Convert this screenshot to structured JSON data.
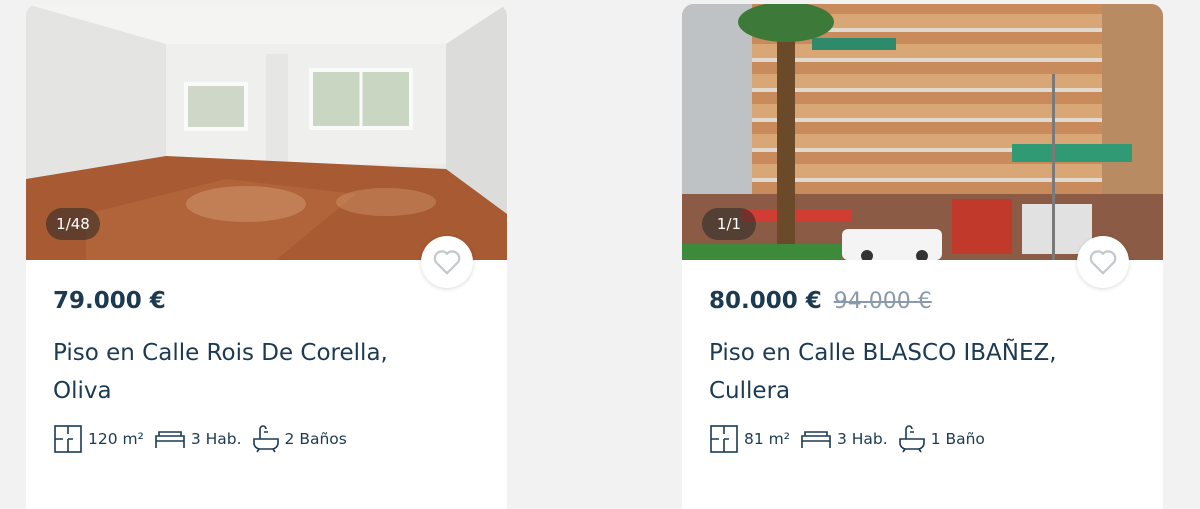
{
  "listings": [
    {
      "photo_counter": "1/48",
      "price": "79.000 €",
      "old_price": "",
      "title": "Piso en Calle Rois De Corella, Oliva",
      "area": "120 m²",
      "rooms": "3 Hab.",
      "baths": "2 Baños",
      "icons": {
        "favorite": "heart-outline-icon",
        "area": "floorplan-icon",
        "rooms": "bed-icon",
        "baths": "bathtub-icon"
      }
    },
    {
      "photo_counter": "1/1",
      "price": "80.000 €",
      "old_price": "94.000 €",
      "title": "Piso en Calle BLASCO IBAÑEZ, Cullera",
      "area": "81 m²",
      "rooms": "3 Hab.",
      "baths": "1 Baño",
      "icons": {
        "favorite": "heart-outline-icon",
        "area": "floorplan-icon",
        "rooms": "bed-icon",
        "baths": "bathtub-icon"
      }
    }
  ],
  "colors": {
    "text": "#1c3a52",
    "old_price": "#8a9aab",
    "background": "#f2f2f2",
    "card": "#ffffff"
  }
}
